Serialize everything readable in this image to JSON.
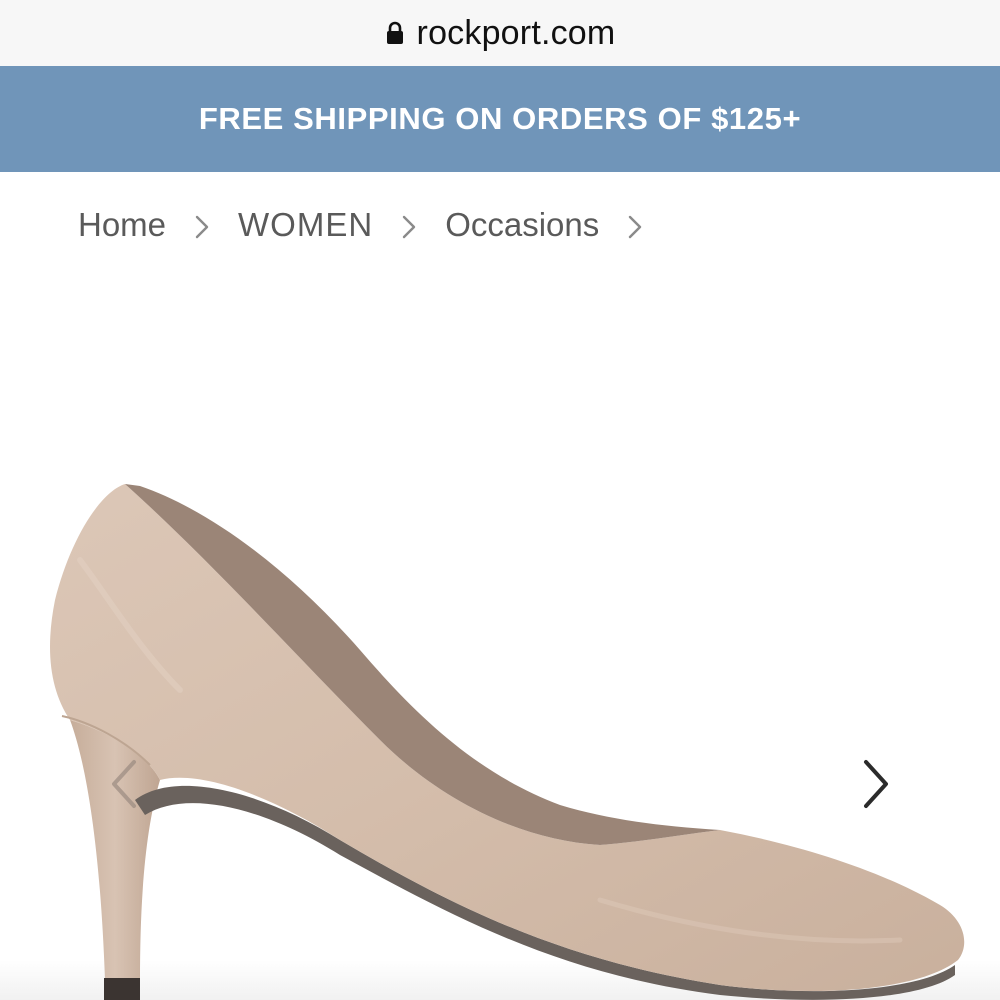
{
  "browser": {
    "url": "rockport.com",
    "lock_icon": "lock-icon"
  },
  "promo": {
    "text": "FREE SHIPPING ON ORDERS OF $125+",
    "background": "#7095b9",
    "color": "#ffffff"
  },
  "breadcrumb": {
    "items": [
      {
        "label": "Home"
      },
      {
        "label": "WOMEN"
      },
      {
        "label": "Occasions"
      }
    ],
    "separator_icon": "chevron-right-icon"
  },
  "product": {
    "image": "beige-suede-pump-heel",
    "shoe_color": "#d6bfae",
    "carousel": {
      "prev_icon": "chevron-left-icon",
      "next_icon": "chevron-right-icon"
    }
  }
}
